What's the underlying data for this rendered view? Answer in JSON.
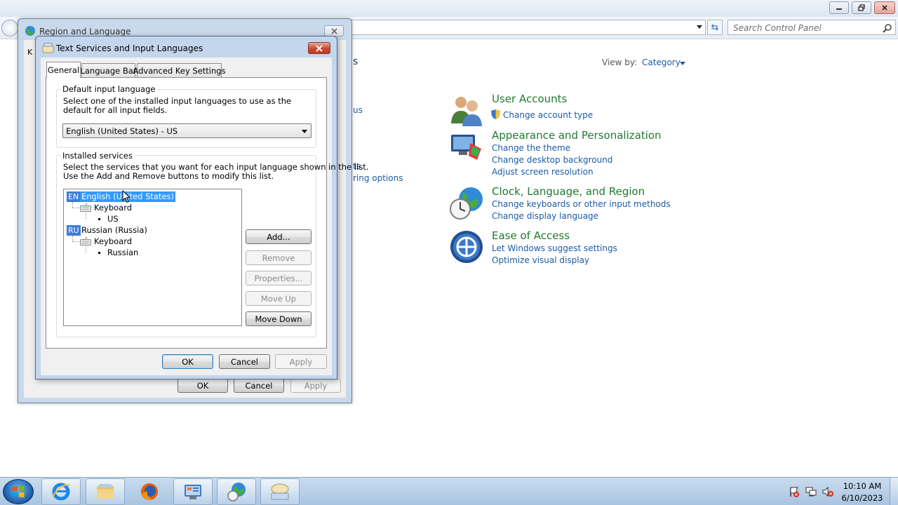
{
  "control_panel": {
    "search_placeholder": "Search Control Panel",
    "partial_heading": "s",
    "partial_links": [
      "us",
      "ts",
      "ring options"
    ],
    "view_by_label": "View by:",
    "view_by_value": "Category",
    "categories": [
      {
        "title": "User Accounts",
        "icon": "user-accounts-icon",
        "links": [
          "Change account type"
        ]
      },
      {
        "title": "Appearance and Personalization",
        "icon": "appearance-icon",
        "links": [
          "Change the theme",
          "Change desktop background",
          "Adjust screen resolution"
        ]
      },
      {
        "title": "Clock, Language, and Region",
        "icon": "clock-globe-icon",
        "links": [
          "Change keyboards or other input methods",
          "Change display language"
        ]
      },
      {
        "title": "Ease of Access",
        "icon": "ease-of-access-icon",
        "links": [
          "Let Windows suggest settings",
          "Optimize visual display"
        ]
      }
    ]
  },
  "region_window": {
    "title": "Region and Language",
    "partial_text": "K",
    "ok_label": "OK",
    "cancel_label": "Cancel",
    "apply_label": "Apply"
  },
  "text_services": {
    "title": "Text Services and Input Languages",
    "tabs": [
      "General",
      "Language Bar",
      "Advanced Key Settings"
    ],
    "active_tab": "General",
    "default_group": {
      "label": "Default input language",
      "description": "Select one of the installed input languages to use as the default for all input fields.",
      "selected": "English (United States) - US"
    },
    "installed_group": {
      "label": "Installed services",
      "description_line1": "Select the services that you want for each input language shown in the list.",
      "description_line2": "Use the Add and Remove buttons to modify this list.",
      "tree": [
        {
          "badge": "EN",
          "language": "English (United States)",
          "selected": true,
          "category": "Keyboard",
          "layout": "US"
        },
        {
          "badge": "RU",
          "language": "Russian (Russia)",
          "selected": false,
          "category": "Keyboard",
          "layout": "Russian"
        }
      ],
      "buttons": {
        "add": "Add...",
        "remove": "Remove",
        "properties": "Properties...",
        "move_up": "Move Up",
        "move_down": "Move Down"
      }
    },
    "ok_label": "OK",
    "cancel_label": "Cancel",
    "apply_label": "Apply"
  },
  "taskbar": {
    "pinned": [
      "internet-explorer-icon",
      "file-explorer-icon",
      "firefox-icon",
      "control-panel-icon",
      "region-language-icon",
      "text-services-icon"
    ],
    "tray": [
      "action-center-icon",
      "network-icon",
      "volume-muted-icon"
    ],
    "time": "10:10 AM",
    "date": "6/10/2023"
  },
  "colors": {
    "link_blue": "#1a5ba6",
    "category_green": "#1e7a2e",
    "selection_blue": "#3399ff",
    "close_red": "#c9472f"
  }
}
